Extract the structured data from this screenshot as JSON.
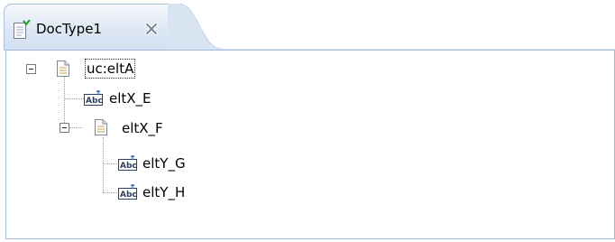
{
  "tab": {
    "title": "DocType1"
  },
  "tree": {
    "root": {
      "label": "uc:eltA",
      "icon": "document-icon",
      "expanded": true,
      "selected": true
    },
    "nodes": [
      {
        "label": "eltX_E",
        "icon": "abc-text-icon"
      },
      {
        "label": "eltX_F",
        "icon": "document-icon",
        "expanded": true
      },
      {
        "label": "eltY_G",
        "icon": "abc-text-icon"
      },
      {
        "label": "eltY_H",
        "icon": "abc-text-icon"
      }
    ]
  },
  "colors": {
    "tab_gradient_top": "#f7f9fd",
    "tab_gradient_bottom": "#d3e0f1",
    "panel_border": "#a5b9d5",
    "tree_line": "#a0a0a0"
  }
}
